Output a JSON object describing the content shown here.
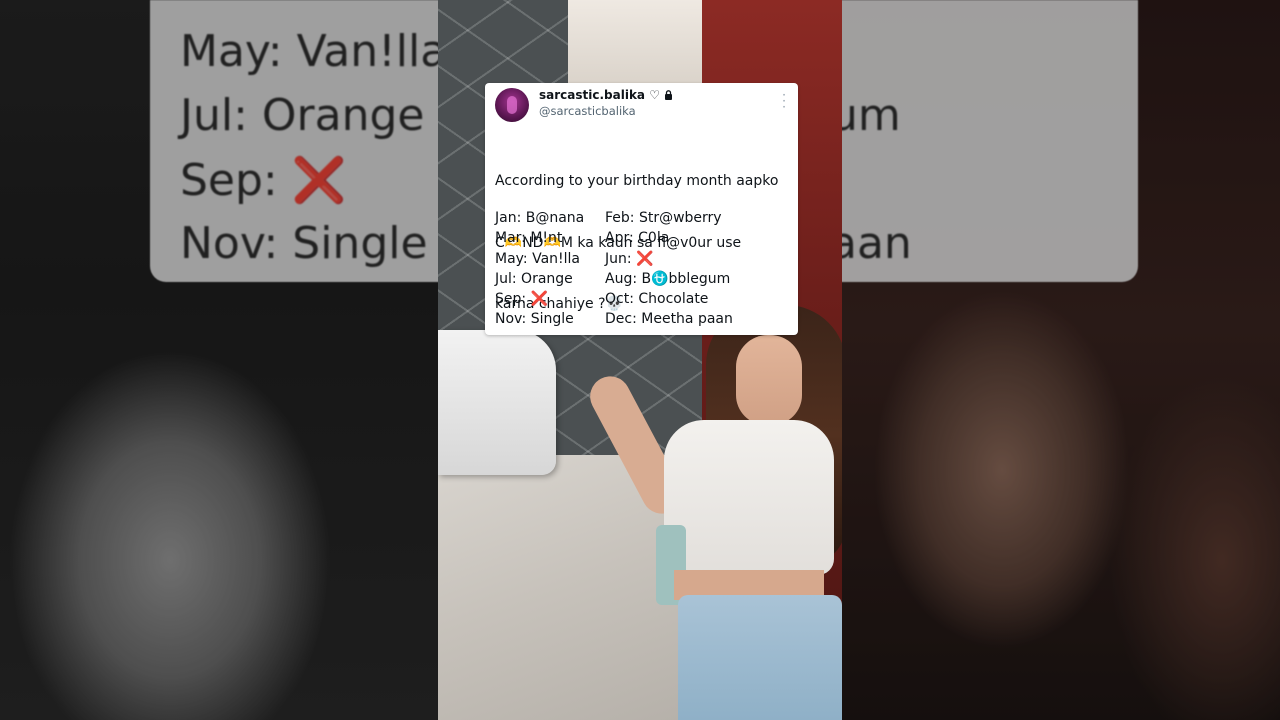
{
  "background_side_text": {
    "left": [
      "May: Van!lla",
      "Jul: Orange",
      "Sep: ❌",
      "Nov: Single"
    ],
    "right": [
      "um",
      "aan"
    ]
  },
  "tweet": {
    "display_name": "sarcastic.balika",
    "name_deco": "♡",
    "handle": "@sarcasticbalika",
    "lines": [
      "According to your birthday month aapko",
      "C🫶ND🫶M ka kaun sa fl@v0ur use",
      "karna chahiye ?💀"
    ],
    "months": [
      {
        "left": "Jan: B@nana",
        "right": "Feb: Str@wberry"
      },
      {
        "left": "Mar: M!nt",
        "right": "Apr: C0la"
      },
      {
        "left": "May: Van!lla",
        "right": "Jun: ❌"
      },
      {
        "left": "Jul: Orange",
        "right": "Aug: B⛎bblegum"
      },
      {
        "left": "Sep: ❌",
        "right": "Oct: Chocolate"
      },
      {
        "left": "Nov: Single",
        "right": "Dec: Meetha paan"
      }
    ]
  },
  "colors": {
    "tweet_bg": "#ffffff",
    "text": "#0f1419",
    "handle": "#536471"
  },
  "icons": [
    "lock-icon",
    "more-icon",
    "avatar"
  ]
}
